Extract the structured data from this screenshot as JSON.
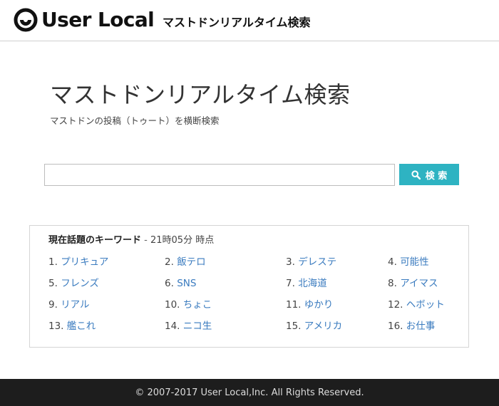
{
  "header": {
    "logo_text": "User Local",
    "title": "マストドンリアルタイム検索"
  },
  "main": {
    "title": "マストドンリアルタイム検索",
    "subtitle": "マストドンの投稿（トゥート）を横断検索"
  },
  "search": {
    "value": "",
    "placeholder": "",
    "button_label": "検 索",
    "button_icon": "search-icon",
    "accent_color": "#2eb3c2"
  },
  "keywords": {
    "heading": "現在話題のキーワード",
    "separator": " - ",
    "time": "21時05分 時点",
    "link_color": "#3a7bbf",
    "items": [
      {
        "num": "1.",
        "label": "プリキュア"
      },
      {
        "num": "2.",
        "label": "飯テロ"
      },
      {
        "num": "3.",
        "label": "デレステ"
      },
      {
        "num": "4.",
        "label": "可能性"
      },
      {
        "num": "5.",
        "label": "フレンズ"
      },
      {
        "num": "6.",
        "label": "SNS"
      },
      {
        "num": "7.",
        "label": "北海道"
      },
      {
        "num": "8.",
        "label": "アイマス"
      },
      {
        "num": "9.",
        "label": "リアル"
      },
      {
        "num": "10.",
        "label": "ちょこ"
      },
      {
        "num": "11.",
        "label": "ゆかり"
      },
      {
        "num": "12.",
        "label": "ヘボット"
      },
      {
        "num": "13.",
        "label": "艦これ"
      },
      {
        "num": "14.",
        "label": "ニコ生"
      },
      {
        "num": "15.",
        "label": "アメリカ"
      },
      {
        "num": "16.",
        "label": "お仕事"
      }
    ]
  },
  "footer": {
    "copyright": "© 2007-2017 User Local,Inc. All Rights Reserved."
  }
}
